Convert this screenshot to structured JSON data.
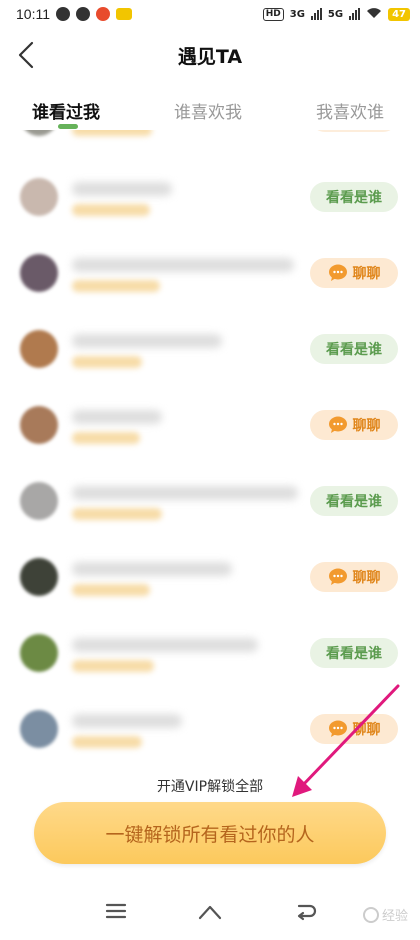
{
  "status_bar": {
    "time": "10:11",
    "network_a": "3G",
    "network_b": "5G",
    "hd_label": "HD",
    "battery": "47"
  },
  "header": {
    "title": "遇见TA"
  },
  "tabs": [
    {
      "label": "谁看过我",
      "active": true
    },
    {
      "label": "谁喜欢我",
      "active": false
    },
    {
      "label": "我喜欢谁",
      "active": false
    }
  ],
  "actions": {
    "see_label": "看看是谁",
    "chat_label": "聊聊"
  },
  "rows": [
    {
      "action": "see",
      "avatar_color": "#c9b8ae",
      "name_w": 100,
      "sub_w": 78
    },
    {
      "action": "chat",
      "avatar_color": "#6a5a68",
      "name_w": 222,
      "sub_w": 88
    },
    {
      "action": "see",
      "avatar_color": "#b07a4e",
      "name_w": 150,
      "sub_w": 70
    },
    {
      "action": "chat",
      "avatar_color": "#a87a5a",
      "name_w": 90,
      "sub_w": 68
    },
    {
      "action": "see",
      "avatar_color": "#a8a7a6",
      "name_w": 226,
      "sub_w": 90
    },
    {
      "action": "chat",
      "avatar_color": "#3e4238",
      "name_w": 160,
      "sub_w": 78
    },
    {
      "action": "see",
      "avatar_color": "#6c8a44",
      "name_w": 186,
      "sub_w": 82
    },
    {
      "action": "chat",
      "avatar_color": "#7b8ea2",
      "name_w": 110,
      "sub_w": 70
    }
  ],
  "unlock": {
    "caption": "开通VIP解锁全部",
    "button_label": "一键解锁所有看过你的人"
  },
  "watermark": "经验",
  "colors": {
    "accent_green": "#66b25a",
    "see_bg": "#e9f3e4",
    "chat_bg": "#fde9d2",
    "unlock_bg": "#fcc95c",
    "annotation_arrow": "#e0197d"
  }
}
